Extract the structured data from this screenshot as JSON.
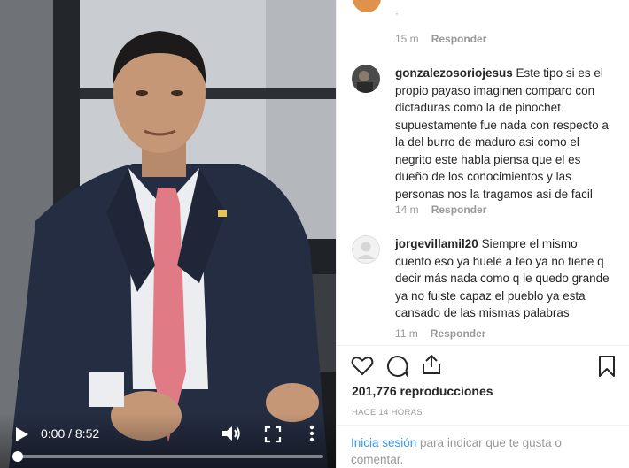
{
  "video": {
    "time": "0:00 / 8:52",
    "progress": 0.0
  },
  "comments": [
    {
      "username": "gonzalezosoriojesus",
      "text": "Este tipo si es el propio payaso imaginen comparo con dictaduras como la de pinochet supuestamente fue nada con respecto a la del burro de maduro asi como el negrito este habla piensa que el es dueño de los conocimientos y las personas nos la tragamos asi de facil",
      "time": "14 m",
      "reply": "Responder"
    },
    {
      "username": "jorgevillamil20",
      "text": "Siempre el mismo cuento eso ya huele a feo ya no tiene q decir más nada como q le quedo grande ya no fuiste capaz el pueblo ya esta cansado de las mismas palabras",
      "time": "11 m",
      "reply": "Responder"
    }
  ],
  "top_comment_meta": {
    "time": "15 m",
    "reply": "Responder"
  },
  "actions": {
    "views": "201,776 reproducciones",
    "posted": "HACE 14 HORAS"
  },
  "login_prompt": {
    "link": "Inicia sesión",
    "text": " para indicar que te gusta o comentar."
  },
  "colors": {
    "link": "#3897f0",
    "muted": "#999999",
    "text": "#262626"
  }
}
